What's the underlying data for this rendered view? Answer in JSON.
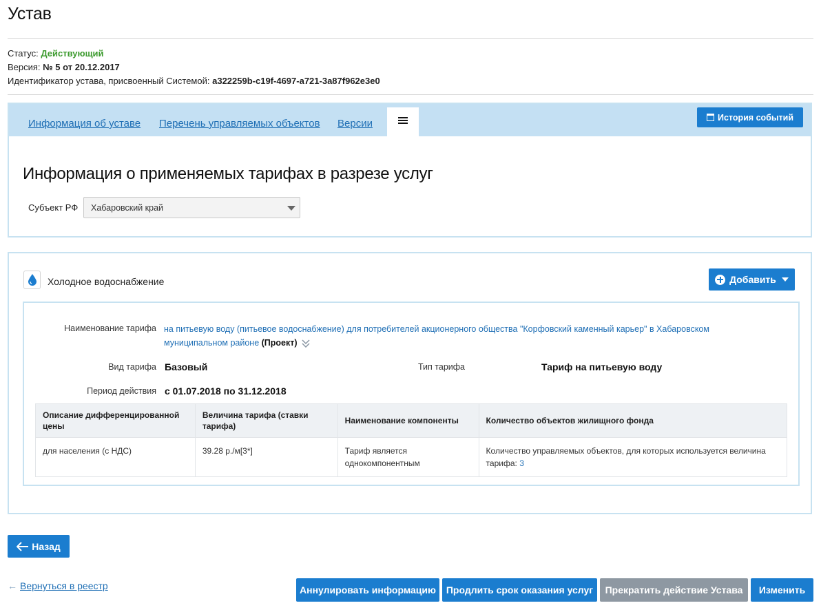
{
  "page": {
    "title": "Устав",
    "status_label": "Статус:",
    "status_value": "Действующий",
    "version_label": "Версия:",
    "version_value": "№ 5 от 20.12.2017",
    "id_label": "Идентификатор устава, присвоенный Системой:",
    "id_value": "a322259b-c19f-4697-a721-3a87f962e3e0"
  },
  "tabs": [
    {
      "label": "Информация об уставе"
    },
    {
      "label": "Перечень управляемых объектов"
    },
    {
      "label": "Версии"
    }
  ],
  "active_tab_icon": "list-icon",
  "history_button": {
    "label": "История событий",
    "icon": "calendar-icon"
  },
  "section": {
    "title": "Информация о применяемых тарифах в разрезе услуг",
    "subject_label": "Субъект РФ",
    "subject_value": "Хабаровский край"
  },
  "service": {
    "icon": "water-drop-icon",
    "title": "Холодное водоснабжение",
    "add_button": "Добавить"
  },
  "tariff": {
    "name_label": "Наименование тарифа",
    "name_value": "на питьевую воду (питьевое водоснабжение) для потребителей акционерного общества \"Корфовский каменный карьер\" в Хабаровском муниципальном районе",
    "name_status": "(Проект)",
    "kind_label": "Вид тарифа",
    "kind_value": "Базовый",
    "type_label": "Тип тарифа",
    "type_value": "Тариф на питьевую воду",
    "period_label": "Период действия",
    "period_value": "с 01.07.2018 по 31.12.2018"
  },
  "table": {
    "headers": [
      "Описание дифференцированной цены",
      "Величина тарифа (ставки тарифа)",
      "Наименование компоненты",
      "Количество объектов жилищного фонда"
    ],
    "rows": [
      {
        "description": "для населения (с НДС)",
        "value": "39.28 р./м[3*]",
        "component": "Тариф является однокомпонентным",
        "objects_text": "Количество управляемых объектов, для которых используется величина тарифа:",
        "objects_count": "3"
      }
    ]
  },
  "footer": {
    "back_button": "Назад",
    "registry_link": "Вернуться в реестр",
    "annul_button": "Аннулировать информацию",
    "extend_button": "Продлить срок оказания услуг",
    "terminate_button": "Прекратить действие Устава",
    "edit_button": "Изменить"
  },
  "colors": {
    "accent": "#1b7dcf",
    "status_active": "#3d9b2f",
    "tab_bar": "#c4e0f3",
    "disabled_button": "#8e98a2"
  }
}
